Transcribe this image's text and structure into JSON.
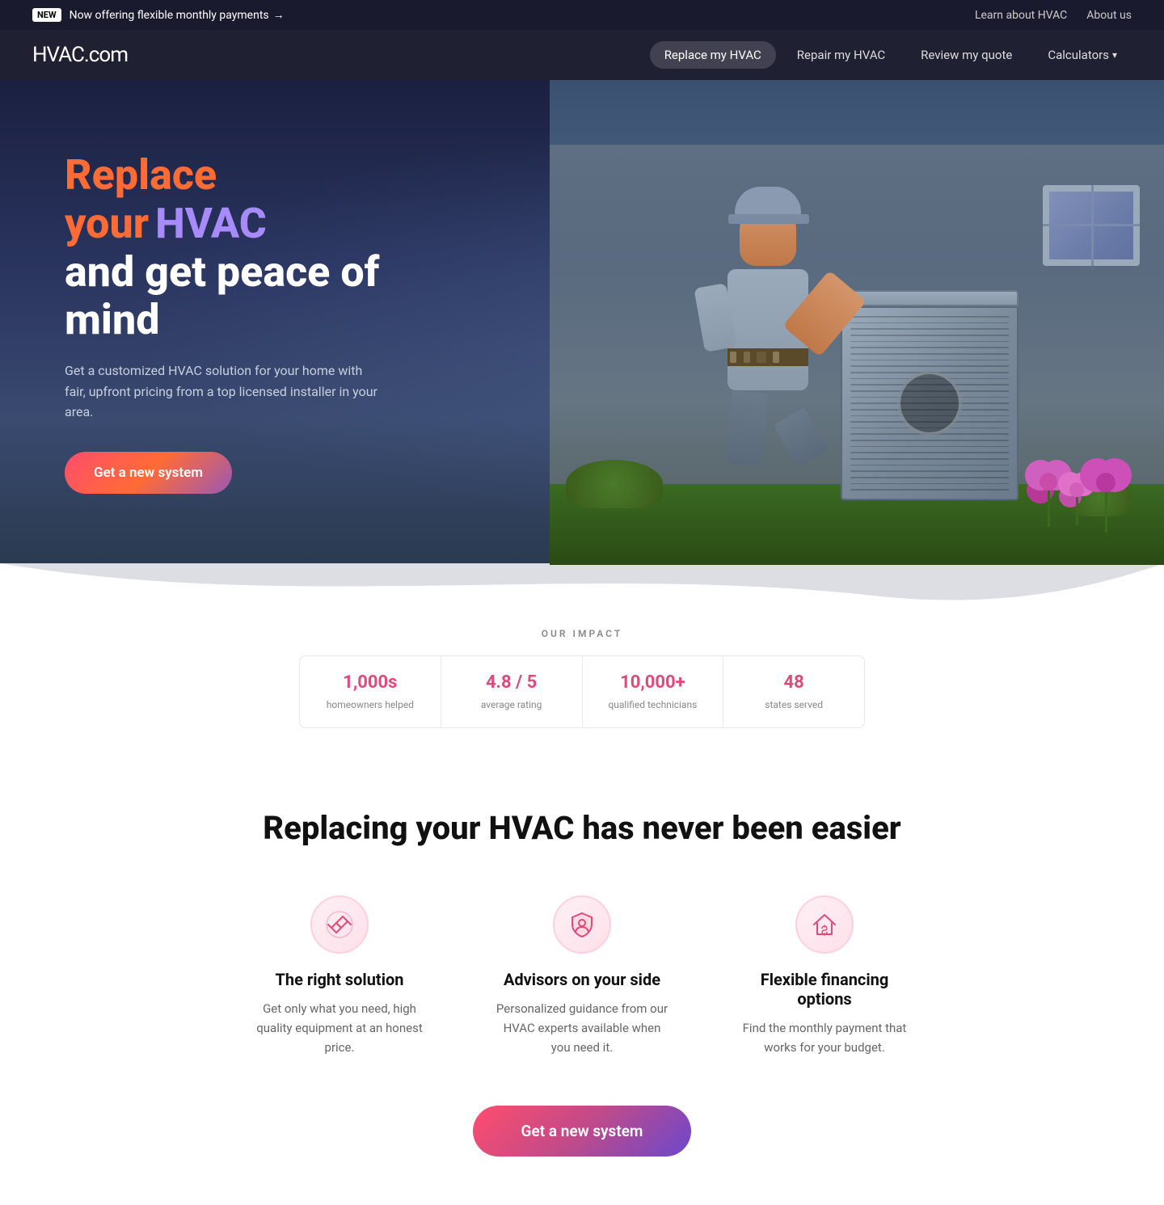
{
  "topBanner": {
    "badge": "NEW",
    "message": "Now offering flexible monthly payments",
    "arrow": "→",
    "links": [
      "Learn about HVAC",
      "About us"
    ]
  },
  "nav": {
    "logo": "HVAC",
    "logoDomain": ".com",
    "links": [
      {
        "label": "Replace my HVAC",
        "active": true
      },
      {
        "label": "Repair my HVAC",
        "active": false
      },
      {
        "label": "Review my quote",
        "active": false
      },
      {
        "label": "Calculators",
        "active": false,
        "hasDropdown": true
      }
    ]
  },
  "hero": {
    "titleOrange": "Replace your",
    "titlePurple": "HVAC",
    "titleWhite": "and get peace of mind",
    "subtitle": "Get a customized HVAC solution for your home with fair, upfront pricing from a top licensed installer in your area.",
    "ctaButton": "Get a new system"
  },
  "impact": {
    "label": "OUR IMPACT",
    "stats": [
      {
        "number": "1,000s",
        "desc": "homeowners helped"
      },
      {
        "number": "4.8 / 5",
        "desc": "average rating"
      },
      {
        "number": "10,000+",
        "desc": "qualified technicians"
      },
      {
        "number": "48",
        "desc": "states served"
      }
    ]
  },
  "easySection": {
    "title": "Replacing your HVAC has never been easier",
    "features": [
      {
        "iconUnicode": "🤝",
        "title": "The right solution",
        "desc": "Get only what you need, high quality equipment at an honest price."
      },
      {
        "iconUnicode": "🛡",
        "title": "Advisors on your side",
        "desc": "Personalized guidance from our HVAC experts available when you need it."
      },
      {
        "iconUnicode": "🏠",
        "title": "Flexible financing options",
        "desc": "Find the monthly payment that works for your budget."
      }
    ],
    "ctaButton": "Get a new system"
  },
  "colors": {
    "primary": "#e04a7a",
    "gradientStart": "#ff4d6d",
    "gradientMid": "#c04a8a",
    "gradientEnd": "#6b48cc",
    "logoColor": "#ff4d6d",
    "titleOrange": "#ff6b35",
    "titlePurple": "#a78bfa"
  }
}
